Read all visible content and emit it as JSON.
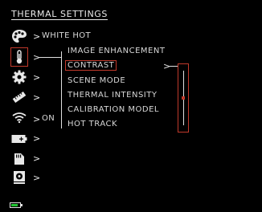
{
  "header": {
    "title": "THERMAL SETTINGS"
  },
  "left_menu": {
    "items": [
      {
        "icon": "palette-icon",
        "label": "WHITE HOT"
      },
      {
        "icon": "thermometer-icon",
        "label": "",
        "selected": true
      },
      {
        "icon": "gear-icon",
        "label": ""
      },
      {
        "icon": "ruler-icon",
        "label": ""
      },
      {
        "icon": "wifi-icon",
        "label": "ON"
      },
      {
        "icon": "battery-add-icon",
        "label": ""
      },
      {
        "icon": "sd-card-icon",
        "label": ""
      },
      {
        "icon": "recorder-icon",
        "label": ""
      }
    ],
    "chevron": ">"
  },
  "submenu": {
    "items": [
      "IMAGE ENHANCEMENT",
      "CONTRAST",
      "SCENE MODE",
      "THERMAL INTENSITY",
      "CALIBRATION MODEL",
      "HOT TRACK"
    ],
    "active_index": 1,
    "pointer": ">"
  },
  "slider": {
    "value": 0.5
  },
  "status": {
    "battery_level": 0.75
  },
  "colors": {
    "accent": "#c0392b",
    "battery": "#22c433"
  }
}
